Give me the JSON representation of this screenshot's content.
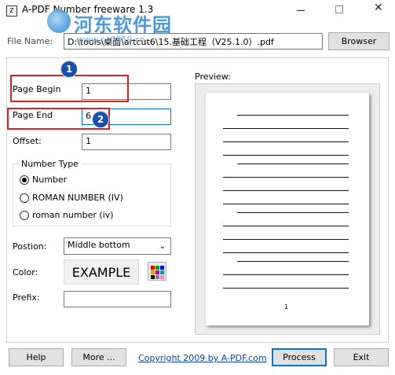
{
  "window": {
    "title": "A-PDF Number freeware 1.3",
    "icon_text": "Z",
    "watermark_text": "河东软件园",
    "watermark_url": "www.pc0359.cn",
    "close_glyph": "✕"
  },
  "file": {
    "label": "File Name:",
    "value": "D:\\tools\\桌面\\artcut6\\15.基础工程（V25.1.0）.pdf",
    "browse_button": "Browser"
  },
  "fields": {
    "page_begin_label": "Page Begin",
    "page_begin_value": "1",
    "page_end_label": "Page End",
    "page_end_value": "6",
    "offset_label": "Offset:",
    "offset_value": "1"
  },
  "number_type": {
    "title": "Number Type",
    "options": [
      "Number",
      "ROMAN NUMBER (IV)",
      "roman number (iv)"
    ],
    "selected_index": 0
  },
  "position": {
    "label": "Postion:",
    "value": "Middle bottom",
    "chevron": "⌄"
  },
  "color": {
    "label": "Color:",
    "example_text": "EXAMPLE",
    "palette": [
      "#e00000",
      "#00a000",
      "#0000e0",
      "#e0a000",
      "#a000a0",
      "#00a0a0",
      "#000000",
      "#808080",
      "#ff80c0"
    ]
  },
  "prefix": {
    "label": "Prefix:",
    "value": ""
  },
  "preview": {
    "label": "Preview:",
    "page_number": "1"
  },
  "annotations": {
    "badge_1": "1",
    "badge_2": "2"
  },
  "footer": {
    "help_button": "Help",
    "more_button": "More ...",
    "copyright_link": "Copyright 2009 by A-PDF.com",
    "process_button": "Process",
    "exit_button": "Exit"
  }
}
